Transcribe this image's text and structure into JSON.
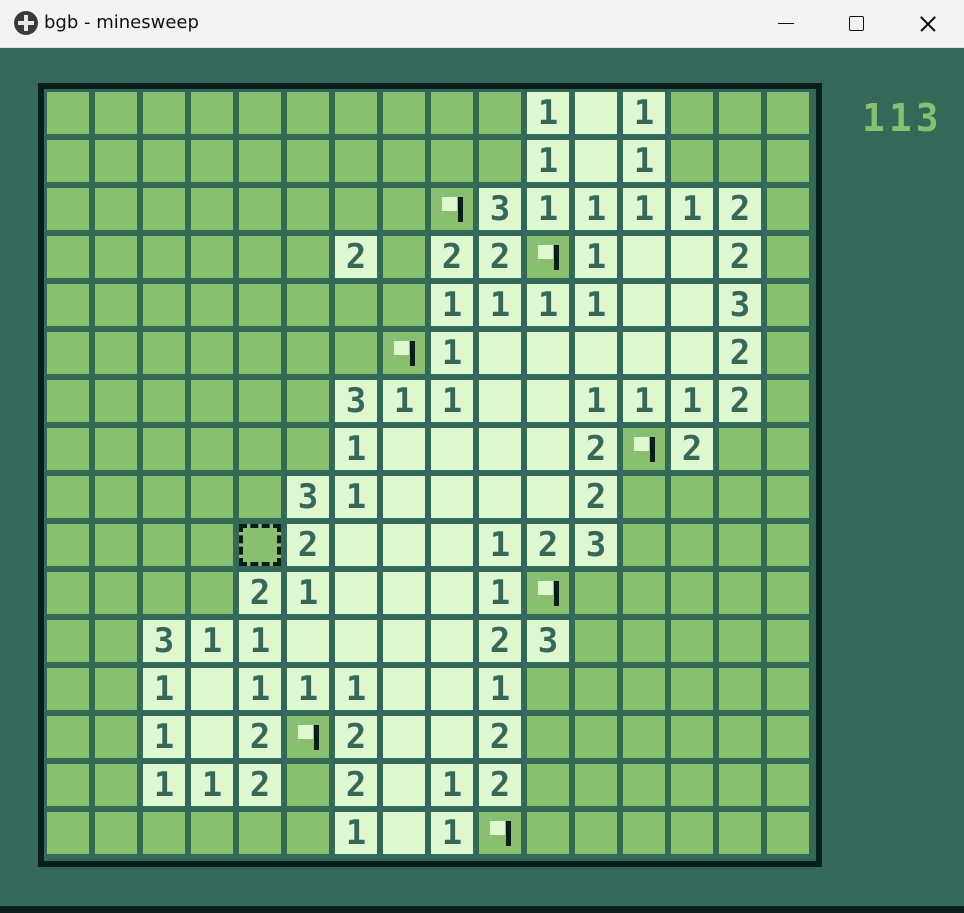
{
  "window": {
    "title": "bgb - minesweep",
    "app_icon": "gameboy-cross-icon",
    "controls": {
      "minimize_icon": "minimize-icon",
      "maximize_icon": "maximize-icon",
      "close_icon": "close-icon"
    }
  },
  "game": {
    "mine_counter": "113",
    "cursor": {
      "row": 9,
      "col": 4
    },
    "legend": {
      "H": "hidden",
      "O": "open-empty",
      "F": "flagged",
      "1-9": "adjacent-mine-count"
    },
    "rows": [
      [
        "H",
        "H",
        "H",
        "H",
        "H",
        "H",
        "H",
        "H",
        "H",
        "H",
        "1",
        "O",
        "1",
        "H",
        "H",
        "H"
      ],
      [
        "H",
        "H",
        "H",
        "H",
        "H",
        "H",
        "H",
        "H",
        "H",
        "H",
        "1",
        "O",
        "1",
        "H",
        "H",
        "H"
      ],
      [
        "H",
        "H",
        "H",
        "H",
        "H",
        "H",
        "H",
        "H",
        "F",
        "3",
        "1",
        "1",
        "1",
        "1",
        "2",
        "H"
      ],
      [
        "H",
        "H",
        "H",
        "H",
        "H",
        "H",
        "2",
        "H",
        "2",
        "2",
        "F",
        "1",
        "O",
        "O",
        "2",
        "H"
      ],
      [
        "H",
        "H",
        "H",
        "H",
        "H",
        "H",
        "H",
        "H",
        "1",
        "1",
        "1",
        "1",
        "O",
        "O",
        "3",
        "H"
      ],
      [
        "H",
        "H",
        "H",
        "H",
        "H",
        "H",
        "H",
        "F",
        "1",
        "O",
        "O",
        "O",
        "O",
        "O",
        "2",
        "H"
      ],
      [
        "H",
        "H",
        "H",
        "H",
        "H",
        "H",
        "3",
        "1",
        "1",
        "O",
        "O",
        "1",
        "1",
        "1",
        "2",
        "H"
      ],
      [
        "H",
        "H",
        "H",
        "H",
        "H",
        "H",
        "1",
        "O",
        "O",
        "O",
        "O",
        "2",
        "F",
        "2",
        "H",
        "H"
      ],
      [
        "H",
        "H",
        "H",
        "H",
        "H",
        "3",
        "1",
        "O",
        "O",
        "O",
        "O",
        "2",
        "H",
        "H",
        "H",
        "H"
      ],
      [
        "H",
        "H",
        "H",
        "H",
        "H",
        "2",
        "O",
        "O",
        "O",
        "1",
        "2",
        "3",
        "H",
        "H",
        "H",
        "H"
      ],
      [
        "H",
        "H",
        "H",
        "H",
        "2",
        "1",
        "O",
        "O",
        "O",
        "1",
        "F",
        "H",
        "H",
        "H",
        "H",
        "H"
      ],
      [
        "H",
        "H",
        "3",
        "1",
        "1",
        "O",
        "O",
        "O",
        "O",
        "2",
        "3",
        "H",
        "H",
        "H",
        "H",
        "H"
      ],
      [
        "H",
        "H",
        "1",
        "O",
        "1",
        "1",
        "1",
        "O",
        "O",
        "1",
        "H",
        "H",
        "H",
        "H",
        "H",
        "H"
      ],
      [
        "H",
        "H",
        "1",
        "O",
        "2",
        "F",
        "2",
        "O",
        "O",
        "2",
        "H",
        "H",
        "H",
        "H",
        "H",
        "H"
      ],
      [
        "H",
        "H",
        "1",
        "1",
        "2",
        "H",
        "2",
        "O",
        "1",
        "2",
        "H",
        "H",
        "H",
        "H",
        "H",
        "H"
      ],
      [
        "H",
        "H",
        "H",
        "H",
        "H",
        "H",
        "1",
        "O",
        "1",
        "F",
        "H",
        "H",
        "H",
        "H",
        "H",
        "H"
      ]
    ]
  },
  "colors": {
    "dark": "#0b1d1b",
    "mid": "#34695a",
    "light": "#88c070",
    "lightest": "#e0f8d0"
  }
}
